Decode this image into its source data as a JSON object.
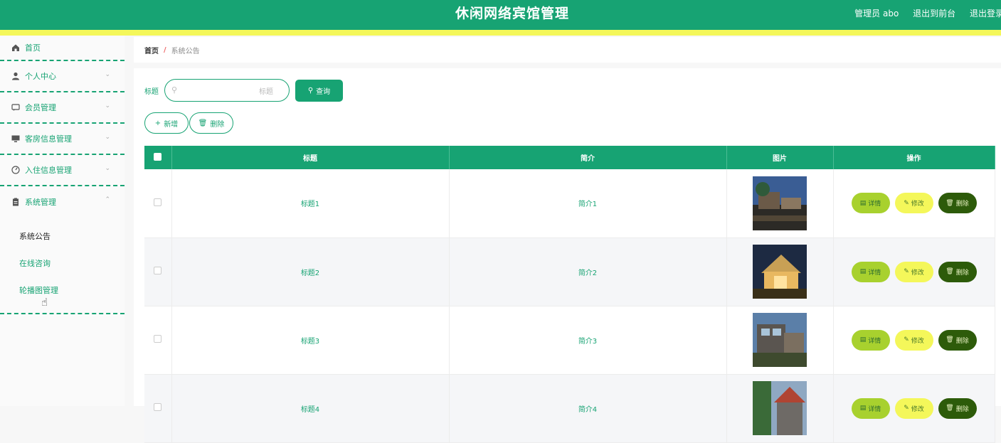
{
  "header": {
    "title": "休闲网络宾馆管理",
    "user": "管理员 abo",
    "to_front": "退出到前台",
    "logout": "退出登录"
  },
  "sidebar": {
    "items": [
      {
        "label": "首页",
        "icon": "home-icon"
      },
      {
        "label": "个人中心",
        "icon": "user-icon"
      },
      {
        "label": "会员管理",
        "icon": "chat-icon"
      },
      {
        "label": "客房信息管理",
        "icon": "monitor-icon"
      },
      {
        "label": "入住信息管理",
        "icon": "gauge-icon"
      },
      {
        "label": "系统管理",
        "icon": "clipboard-icon"
      }
    ],
    "submenu": [
      "系统公告",
      "在线咨询",
      "轮播图管理"
    ]
  },
  "breadcrumb": {
    "home": "首页",
    "separator": "/",
    "current": "系统公告"
  },
  "search": {
    "label": "标题",
    "placeholder": "标题",
    "button": "查询"
  },
  "actions": {
    "add": "新增",
    "delete": "删除"
  },
  "table": {
    "headers": [
      "标题",
      "简介",
      "图片",
      "操作"
    ],
    "rows": [
      {
        "title": "标题1",
        "intro": "简介1"
      },
      {
        "title": "标题2",
        "intro": "简介2"
      },
      {
        "title": "标题3",
        "intro": "简介3"
      },
      {
        "title": "标题4",
        "intro": "简介4"
      }
    ],
    "row_ops": {
      "detail": "详情",
      "edit": "修改",
      "delete": "删除"
    }
  },
  "colors": {
    "primary": "#17a373",
    "accent": "#f4f75a",
    "detail": "#a8d12e",
    "danger": "#2d5b0a"
  }
}
